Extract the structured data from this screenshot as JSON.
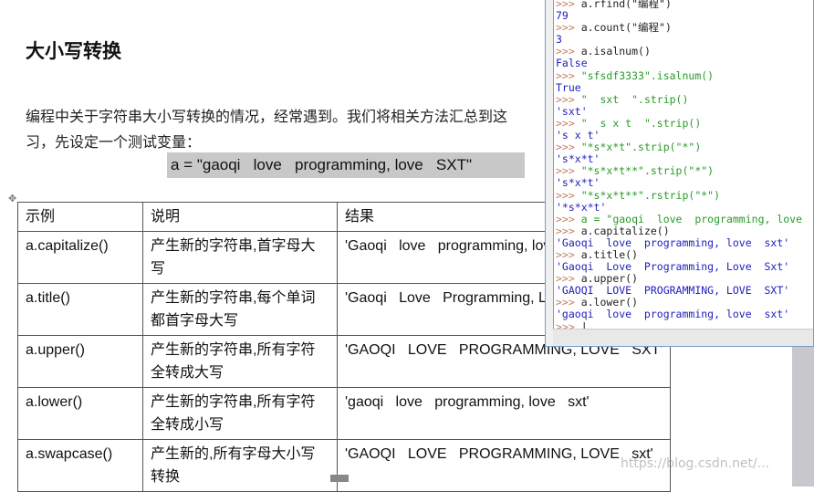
{
  "doc": {
    "title": "大小写转换",
    "para_line1": "编程中关于字符串大小写转换的情况，经常遇到。我们将相关方法汇总到这",
    "para_line2": "习，先设定一个测试变量：",
    "variable": "a = \"gaoqi   love   programming, love   SXT\"",
    "table": {
      "headers": [
        "示例",
        "说明",
        "结果"
      ],
      "rows": [
        [
          "a.capitalize()",
          "产生新的字符串,首字母大写",
          "'Gaoqi   love   programming, love   sxt'"
        ],
        [
          "a.title()",
          "产生新的字符串,每个单词都首字母大写",
          "'Gaoqi   Love   Programming, Love   Sxt'"
        ],
        [
          "a.upper()",
          "产生新的字符串,所有字符全转成大写",
          "'GAOQI   LOVE   PROGRAMMING, LOVE   SXT'"
        ],
        [
          "a.lower()",
          "产生新的字符串,所有字符全转成小写",
          "'gaoqi   love   programming, love   sxt'"
        ],
        [
          "a.swapcase()",
          "产生新的,所有字母大小写转换",
          "'GAOQI   LOVE   PROGRAMMING, LOVE   sxt'"
        ]
      ]
    }
  },
  "shell": {
    "lines": [
      {
        "t": "p",
        "prompt": ">>> ",
        "code": "a.rfind(\"编程\")"
      },
      {
        "t": "o",
        "text": "79"
      },
      {
        "t": "p",
        "prompt": ">>> ",
        "code": "a.count(\"编程\")"
      },
      {
        "t": "o",
        "text": "3"
      },
      {
        "t": "p",
        "prompt": ">>> ",
        "code": "a.isalnum()"
      },
      {
        "t": "o",
        "text": "False"
      },
      {
        "t": "p",
        "prompt": ">>> ",
        "code": "\"sfsdf3333\".isalnum()"
      },
      {
        "t": "o",
        "text": "True"
      },
      {
        "t": "p",
        "prompt": ">>> ",
        "code": "\"  sxt  \".strip()"
      },
      {
        "t": "o",
        "text": "'sxt'"
      },
      {
        "t": "p",
        "prompt": ">>> ",
        "code": "\"  s x t  \".strip()"
      },
      {
        "t": "o",
        "text": "'s x t'"
      },
      {
        "t": "p",
        "prompt": ">>> ",
        "code": "\"*s*x*t\".strip(\"*\")"
      },
      {
        "t": "o",
        "text": "'s*x*t'"
      },
      {
        "t": "p",
        "prompt": ">>> ",
        "code": "\"*s*x*t**\".strip(\"*\")"
      },
      {
        "t": "o",
        "text": "'s*x*t'"
      },
      {
        "t": "p",
        "prompt": ">>> ",
        "code": "\"*s*x*t**\".rstrip(\"*\")"
      },
      {
        "t": "o",
        "text": "'*s*x*t'"
      },
      {
        "t": "p",
        "prompt": ">>> ",
        "code": "a = \"gaoqi  love  programming, love  sxt\""
      },
      {
        "t": "p",
        "prompt": ">>> ",
        "code": "a.capitalize()"
      },
      {
        "t": "o",
        "text": "'Gaoqi  love  programming, love  sxt'"
      },
      {
        "t": "p",
        "prompt": ">>> ",
        "code": "a.title()"
      },
      {
        "t": "o",
        "text": "'Gaoqi  Love  Programming, Love  Sxt'"
      },
      {
        "t": "p",
        "prompt": ">>> ",
        "code": "a.upper()"
      },
      {
        "t": "o",
        "text": "'GAOQI  LOVE  PROGRAMMING, LOVE  SXT'"
      },
      {
        "t": "p",
        "prompt": ">>> ",
        "code": "a.lower()"
      },
      {
        "t": "o",
        "text": "'gaoqi  love  programming, love  sxt'"
      },
      {
        "t": "p",
        "prompt": ">>> ",
        "code": "|"
      }
    ]
  },
  "watermark": "https://blog.csdn.net/..."
}
